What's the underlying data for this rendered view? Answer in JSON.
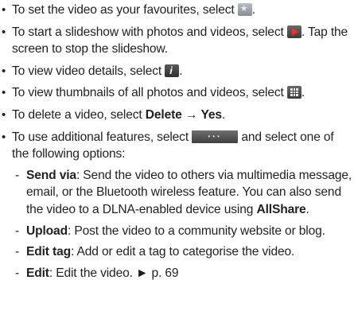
{
  "bullets": [
    {
      "pre": "To set the video as your favourites, select ",
      "icon": "favourite-star-icon",
      "post": "."
    },
    {
      "pre": "To start a slideshow with photos and videos, select ",
      "icon": "slideshow-play-icon",
      "post": ". Tap the screen to stop the slideshow."
    },
    {
      "pre": "To view video details, select ",
      "icon": "info-icon",
      "post": "."
    },
    {
      "pre": "To view thumbnails of all photos and videos, select ",
      "icon": "thumbnail-grid-icon",
      "post": "."
    },
    {
      "pre": "To delete a video, select ",
      "bold1": "Delete",
      "arrow": " → ",
      "bold2": "Yes",
      "post": "."
    },
    {
      "pre": "To use additional features, select ",
      "icon": "more-options-icon",
      "post": " and select one of the following options:"
    }
  ],
  "options": [
    {
      "term": "Send via",
      "desc": ": Send the video to others via multimedia message, email, or the Bluetooth wireless feature. You can also send the video to a DLNA-enabled device using ",
      "term2": "AllShare",
      "tail": "."
    },
    {
      "term": "Upload",
      "desc": ": Post the video to a community website or blog."
    },
    {
      "term": "Edit tag",
      "desc": ": Add or edit a tag to categorise the video."
    },
    {
      "term": "Edit",
      "desc": ": Edit the video. ► p. 69"
    }
  ]
}
